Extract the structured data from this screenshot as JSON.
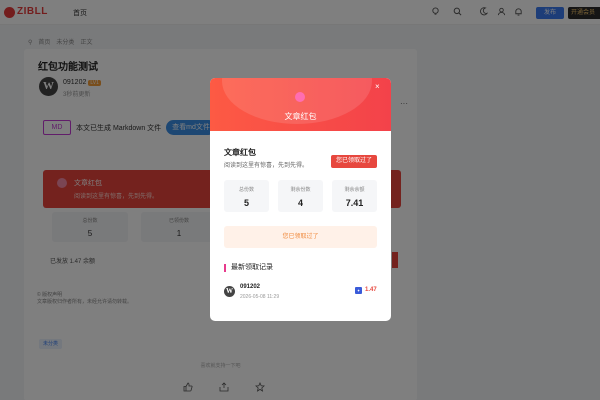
{
  "header": {
    "logo_text": "ZIBLL",
    "nav_home": "首页",
    "post_button": "发布",
    "vip_button": "开通会员"
  },
  "breadcrumb": [
    "首页",
    "未分类",
    "正文"
  ],
  "article": {
    "title": "红包功能测试",
    "author": "091202",
    "level": "LV1",
    "time": "3秒前更新",
    "md_badge": "MD",
    "md_text": "本文已生成 Markdown 文件",
    "md_button": "查看md文件",
    "redpacket": {
      "title": "文章红包",
      "desc": "阅读到这里有惊喜，先到先得。"
    },
    "stats": [
      {
        "label": "总份数",
        "value": "5"
      },
      {
        "label": "已领份数",
        "value": "1"
      }
    ],
    "issued": "已发放 1.47 余额",
    "copyright": [
      "© 版权声明",
      "文章版权归作者所有，未经允许请勿转载。"
    ],
    "category_tag": "未分类",
    "support_text": "喜欢就支持一下吧"
  },
  "modal": {
    "header_title": "文章红包",
    "close": "×",
    "title": "文章红包",
    "desc": "阅读到这里有惊喜，先到先得。",
    "got_badge": "您已领取过了",
    "stats": [
      {
        "label": "总份数",
        "value": "5"
      },
      {
        "label": "剩余份数",
        "value": "4"
      },
      {
        "label": "剩余余额",
        "value": "7.41"
      }
    ],
    "notice": "您已领取过了",
    "records_title": "最新领取记录",
    "records": [
      {
        "name": "091202",
        "time": "2026-05-08 11:29",
        "amount": "1.47"
      }
    ]
  }
}
